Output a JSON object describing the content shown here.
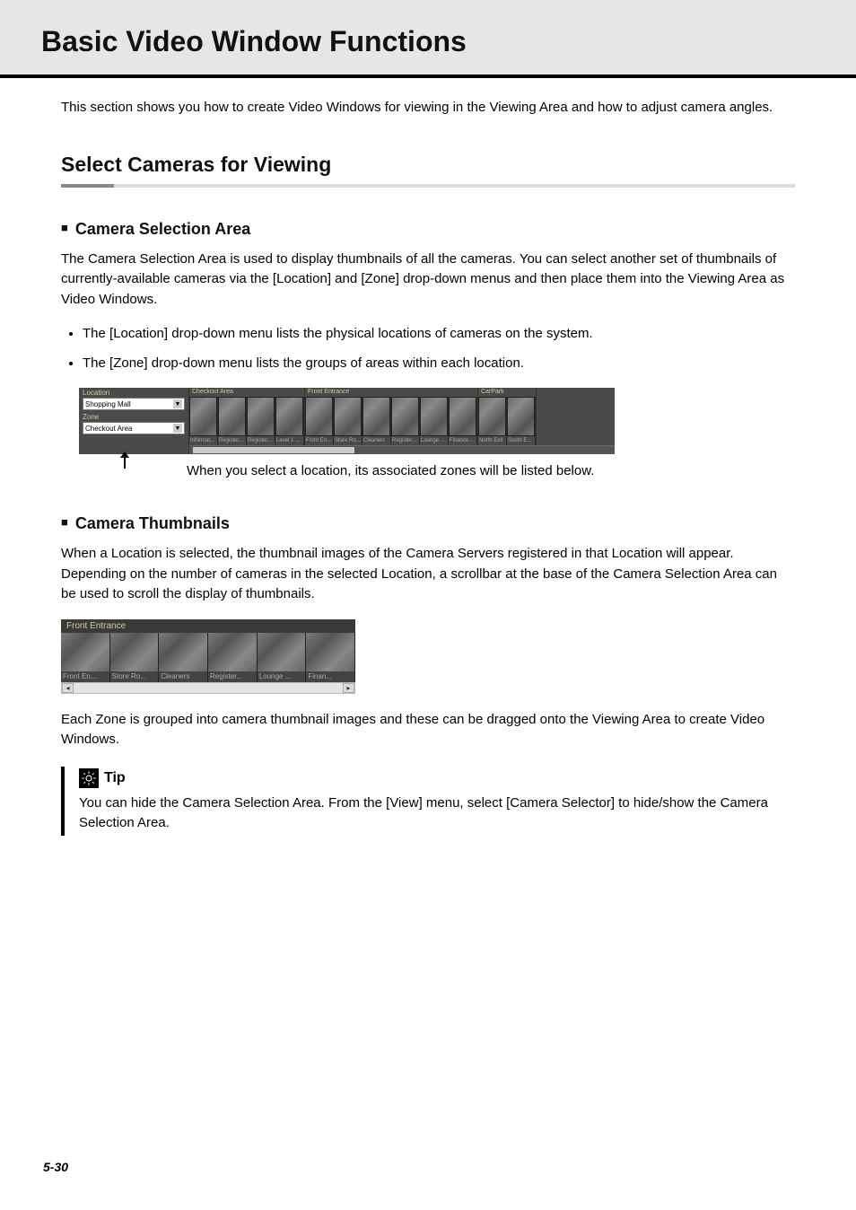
{
  "header": {
    "title": "Basic Video Window Functions"
  },
  "intro": "This section shows you how to create Video Windows for viewing in the Viewing Area and how to adjust camera angles.",
  "section1": {
    "heading": "Select Cameras for Viewing"
  },
  "sub1": {
    "heading": "Camera Selection Area",
    "para_a": "The Camera Selection Area is used to display thumbnails of all the cameras. You can select another set of thumbnails of currently-available cameras via the [",
    "para_b": "Location",
    "para_c": "] and [",
    "para_d": "Zone",
    "para_e": "] drop-down menus and then place them into the Viewing Area as Video Windows.",
    "bullet1_a": "The [",
    "bullet1_b": "Location",
    "bullet1_c": "] drop-down menu lists the physical locations of cameras on the system.",
    "bullet2_a": "The [",
    "bullet2_b": "Zone",
    "bullet2_c": "] drop-down menu lists the groups of areas within each location."
  },
  "fig1": {
    "location_label": "Location",
    "location_value": "Shopping Mall",
    "zone_label": "Zone",
    "zone_value": "Checkout Area",
    "groups": [
      {
        "title": "Checkout Area",
        "thumbs": [
          "Informat...",
          "Register...",
          "Register...",
          "Level 1 ..."
        ]
      },
      {
        "title": "Front Entrance",
        "thumbs": [
          "Front En...",
          "Store Ro...",
          "Cleaners",
          "Register...",
          "Lounge ...",
          "Finance ..."
        ]
      },
      {
        "title": "CarPark",
        "thumbs": [
          "North Exit",
          "South E..."
        ]
      }
    ],
    "caption": "When you select a location, its associated zones will be listed below."
  },
  "sub2": {
    "heading": "Camera Thumbnails",
    "para": "When a Location is selected, the thumbnail images of the Camera Servers registered in that Location will appear. Depending on the number of cameras in the selected Location, a scrollbar at the base of the Camera Selection Area can be used to scroll the display of thumbnails."
  },
  "fig2": {
    "header": "Front Entrance",
    "thumbs": [
      "Front En...",
      "Store Ro...",
      "Cleaners",
      "Register...",
      "Lounge ...",
      "Finan..."
    ]
  },
  "para_after_fig2": "Each Zone is grouped into camera thumbnail images and these can be dragged onto the Viewing Area to create Video Windows.",
  "tip": {
    "title": "Tip",
    "text_a": "You can hide the Camera Selection Area. From the [",
    "text_b": "View",
    "text_c": "] menu, select [",
    "text_d": "Camera Selector",
    "text_e": "] to hide/show the Camera Selection Area."
  },
  "page_number": "5-30"
}
